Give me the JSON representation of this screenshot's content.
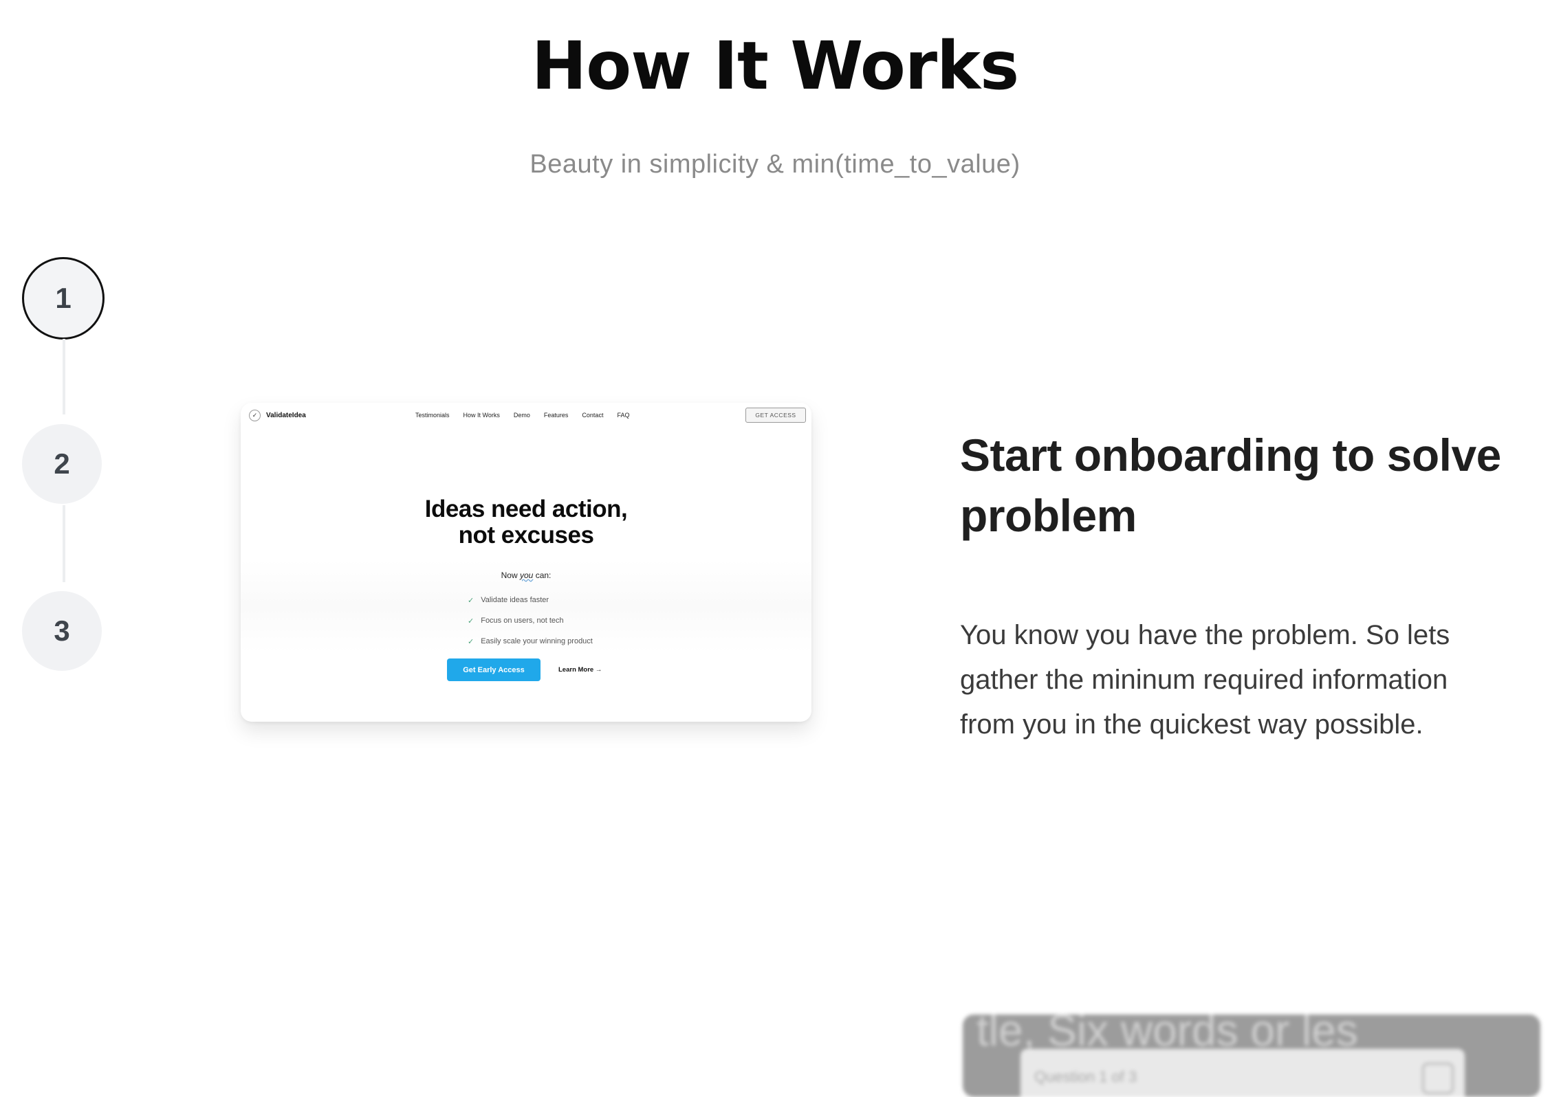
{
  "header": {
    "title": "How It Works",
    "subtitle": "Beauty in simplicity & min(time_to_value)"
  },
  "steps": [
    {
      "label": "1",
      "active": true
    },
    {
      "label": "2",
      "active": false
    },
    {
      "label": "3",
      "active": false
    }
  ],
  "preview": {
    "brand": "ValidateIdea",
    "brand_icon": "checkmark",
    "nav": [
      "Testimonials",
      "How It Works",
      "Demo",
      "Features",
      "Contact",
      "FAQ"
    ],
    "cta": "GET ACCESS",
    "hero_line1": "Ideas need action,",
    "hero_line2": "not excuses",
    "now_prefix": "Now",
    "now_emph": "you",
    "now_suffix": "can:",
    "benefits": [
      "Validate ideas faster",
      "Focus on users, not tech",
      "Easily scale your winning product"
    ],
    "primary_button": "Get Early Access",
    "secondary_link": "Learn More →",
    "accent_color": "#20a8ea"
  },
  "feature": {
    "title": "Start onboarding to solve problem",
    "body": "You know you have the problem. So lets gather the mininum required information from you in the quickest way possible."
  },
  "next_card": {
    "ghost_text": "tle, Six words or les",
    "label": "Question 1 of 3"
  }
}
